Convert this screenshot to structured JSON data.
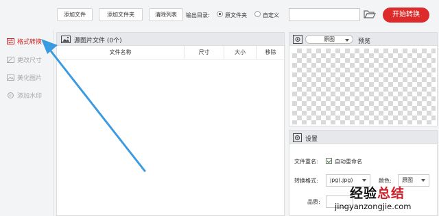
{
  "toolbar": {
    "add_file": "添加文件",
    "add_folder": "添加文件夹",
    "clear_list": "清除列表",
    "output_dir_label": "输出目录:",
    "output_options": [
      {
        "label": "原文件夹",
        "selected": true
      },
      {
        "label": "自定义",
        "selected": false
      }
    ],
    "output_path_value": "",
    "start_label": "开始转换"
  },
  "sidebar": {
    "items": [
      {
        "label": "格式转换",
        "icon": "convert-icon",
        "active": true
      },
      {
        "label": "更改尺寸",
        "icon": "resize-icon",
        "active": false
      },
      {
        "label": "美化图片",
        "icon": "beautify-icon",
        "active": false
      },
      {
        "label": "添加水印",
        "icon": "watermark-icon",
        "active": false
      }
    ]
  },
  "file_panel": {
    "title": "源图片文件 (0个)",
    "columns": [
      "文件名称",
      "尺寸",
      "大小",
      "移除"
    ],
    "rows": []
  },
  "preview": {
    "mode_select": "原图",
    "label": "预览"
  },
  "settings": {
    "title": "设置",
    "rename_label": "文件重名:",
    "auto_rename_label": "自动重命名",
    "auto_rename_checked": true,
    "format_label": "转换格式:",
    "format_value": "jpg(.jpg)",
    "color_label": "颜色:",
    "color_value": "原图",
    "quality_label": "品质:"
  },
  "watermark": {
    "cn_prefix": "经验",
    "cn_suffix": "总结",
    "url": "jingyanzongjie.com"
  },
  "colors": {
    "accent_red": "#dd2b2b",
    "arrow_blue": "#3b9be0"
  }
}
